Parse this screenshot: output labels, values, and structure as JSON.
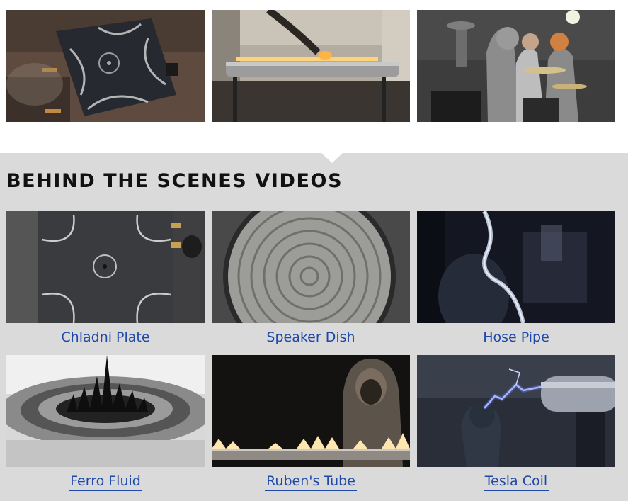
{
  "section": {
    "title": "BEHIND THE SCENES VIDEOS"
  },
  "top_gallery": [
    {
      "image": "chladni-plate-sand-photo"
    },
    {
      "image": "rubens-tube-flame-photo"
    },
    {
      "image": "drummers-tesla-coil-photo"
    }
  ],
  "videos": [
    {
      "caption": "Chladni Plate",
      "thumbnail": "chladni-plate-thumbnail"
    },
    {
      "caption": "Speaker Dish",
      "thumbnail": "speaker-dish-thumbnail"
    },
    {
      "caption": "Hose Pipe",
      "thumbnail": "hose-pipe-thumbnail"
    },
    {
      "caption": "Ferro Fluid",
      "thumbnail": "ferro-fluid-thumbnail"
    },
    {
      "caption": "Ruben's Tube",
      "thumbnail": "rubens-tube-thumbnail"
    },
    {
      "caption": "Tesla Coil",
      "thumbnail": "tesla-coil-thumbnail"
    }
  ],
  "colors": {
    "section_background": "#dadada",
    "link": "#1f49a8",
    "title": "#111111"
  }
}
